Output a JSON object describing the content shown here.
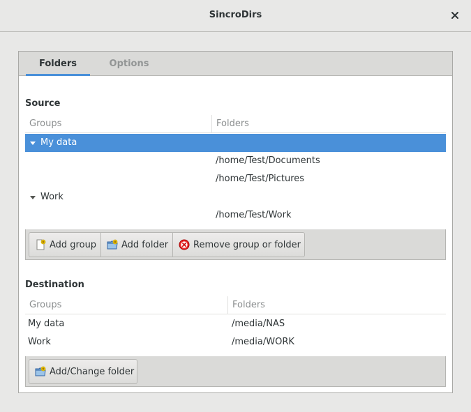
{
  "window": {
    "title": "SincroDirs",
    "close_icon": "close-icon"
  },
  "tabs": [
    {
      "label": "Folders",
      "active": true
    },
    {
      "label": "Options",
      "active": false
    }
  ],
  "source": {
    "title": "Source",
    "columns": {
      "groups": "Groups",
      "folders": "Folders"
    },
    "rows": [
      {
        "group": "My data",
        "folder": "",
        "expanded": true,
        "selected": true
      },
      {
        "group": "",
        "folder": "/home/Test/Documents"
      },
      {
        "group": "",
        "folder": "/home/Test/Pictures"
      },
      {
        "group": "Work",
        "folder": "",
        "expanded": true,
        "selected": false
      },
      {
        "group": "",
        "folder": "/home/Test/Work"
      }
    ],
    "buttons": {
      "add_group": "Add group",
      "add_folder": "Add folder",
      "remove": "Remove group or folder"
    }
  },
  "destination": {
    "title": "Destination",
    "columns": {
      "groups": "Groups",
      "folders": "Folders"
    },
    "rows": [
      {
        "group": "My data",
        "folder": "/media/NAS"
      },
      {
        "group": "Work",
        "folder": "/media/WORK"
      }
    ],
    "buttons": {
      "add_change": "Add/Change folder"
    }
  },
  "colors": {
    "accent": "#4a90d9",
    "remove_icon": "#cc0000"
  }
}
